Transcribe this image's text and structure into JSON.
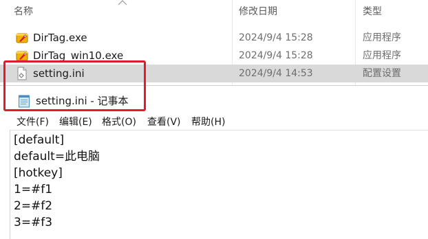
{
  "explorer": {
    "columns": {
      "name": "名称",
      "modified": "修改日期",
      "type": "类型"
    },
    "files": [
      {
        "name": "DirTag.exe",
        "modified": "2024/9/4 15:28",
        "type": "应用程序",
        "icon": "exe-app-icon",
        "selected": false
      },
      {
        "name": "DirTag_win10.exe",
        "modified": "2024/9/4 15:28",
        "type": "应用程序",
        "icon": "exe-app-icon",
        "selected": false
      },
      {
        "name": "setting.ini",
        "modified": "2024/9/4 14:53",
        "type": "配置设置",
        "icon": "ini-file-icon",
        "selected": true
      }
    ]
  },
  "notepad": {
    "title": "setting.ini - 记事本",
    "menu": [
      "文件(F)",
      "编辑(E)",
      "格式(O)",
      "查看(V)",
      "帮助(H)"
    ],
    "lines": [
      "[default]",
      "default=此电脑",
      "[hotkey]",
      "1=#f1",
      "2=#f2",
      "3=#f3"
    ]
  },
  "colors": {
    "highlight": "#e01b2b",
    "selection": "#d9d9d9"
  }
}
